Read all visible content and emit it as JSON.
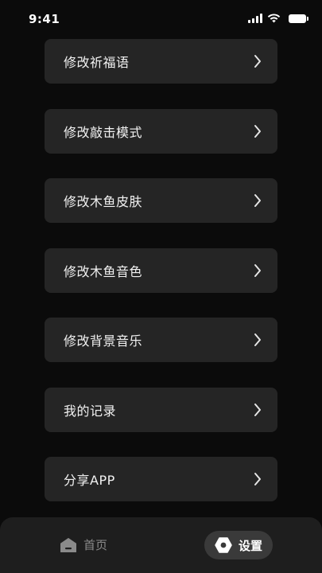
{
  "status_bar": {
    "time": "9:41"
  },
  "menu": {
    "items": [
      {
        "label": "修改祈福语",
        "icon": "chevron-right-icon"
      },
      {
        "label": "修改敲击模式",
        "icon": "chevron-right-icon"
      },
      {
        "label": "修改木鱼皮肤",
        "icon": "chevron-right-icon"
      },
      {
        "label": "修改木鱼音色",
        "icon": "chevron-right-icon"
      },
      {
        "label": "修改背景音乐",
        "icon": "chevron-right-icon"
      },
      {
        "label": "我的记录",
        "icon": "chevron-right-icon"
      },
      {
        "label": "分享APP",
        "icon": "chevron-right-icon"
      }
    ]
  },
  "tab_bar": {
    "home_label": "首页",
    "home_icon": "home-icon",
    "settings_label": "设置",
    "settings_icon": "settings-hexagon-icon",
    "active_tab": "设置"
  },
  "colors": {
    "background": "#0b0b0b",
    "card": "#252525",
    "tab_bar": "#1e1e1e",
    "active_pill": "#3a3a3a",
    "inactive_text": "#8a8a8a"
  }
}
